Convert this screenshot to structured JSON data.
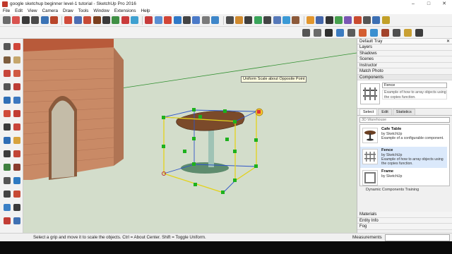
{
  "window": {
    "title": "google sketchup beginner level-1 tutorial - SketchUp Pro 2016",
    "min_glyph": "–",
    "max_glyph": "□",
    "close_glyph": "✕"
  },
  "menu": [
    "File",
    "Edit",
    "View",
    "Camera",
    "Draw",
    "Tools",
    "Window",
    "Extensions",
    "Help"
  ],
  "toolbar": {
    "row1_colors": [
      "#6b6b6b",
      "#d9534f",
      "#3a3a3a",
      "#4a4a4a",
      "#3a73b5",
      "#b8452a",
      "#d04a3a",
      "#4c6db3",
      "#c74a36",
      "#7a3f1e",
      "#3a3a3a",
      "#3f8f44",
      "#c93b3b",
      "#3ea0d0",
      "#c63b3b",
      "#5a8fd3",
      "#d24536",
      "#2f79c8",
      "#444444",
      "#4b7ac8",
      "#7a7a7a",
      "#3e86c9",
      "#4c4c4c",
      "#d08a2e",
      "#3e3e3e",
      "#3aa55a",
      "#444",
      "#5679b9",
      "#3b9ad6",
      "#8d5a3a",
      "#e2962d",
      "#4466aa",
      "#333",
      "#46a04d",
      "#7a56b4",
      "#c94a2f",
      "#555",
      "#3c6fb3",
      "#c2a028"
    ],
    "row2_colors": [
      "#555",
      "#6a6a6a",
      "#2f2f2f",
      "#3c7bc0",
      "#5c5c5c",
      "#d45d30",
      "#3a8fd0",
      "#a2432b",
      "#4f4f4f",
      "#c9a033",
      "#3d3d3d"
    ],
    "left_colors": [
      "#555",
      "#d0463a",
      "#7e5d3e",
      "#c6a76c",
      "#c7453a",
      "#d05a43",
      "#545454",
      "#bd3d36",
      "#2f6fb6",
      "#3c78c0",
      "#d04b3a",
      "#c23c33",
      "#3b3b3b",
      "#c9453b",
      "#2e6db5",
      "#d8a33d",
      "#3c3c3c",
      "#c24536",
      "#3f7f3f",
      "#8a3c2e",
      "#555",
      "#2f7ac2",
      "#444",
      "#c74a35",
      "#3a80c6",
      "#3a3a3a",
      "#c23d35",
      "#4071b3"
    ]
  },
  "tooltip": "Uniform Scale about Opposite Point",
  "tray": {
    "title": "Default Tray",
    "sections_top": [
      "Layers",
      "Shadows",
      "Scenes",
      "Instructor",
      "Match Photo",
      "Components"
    ],
    "component_name": "Fence",
    "component_desc": "Example of how to array objects using the copies function.",
    "tabs": [
      "Select",
      "Edit",
      "Statistics"
    ],
    "search_placeholder": "3D Warehouse",
    "items": [
      {
        "name": "Cafe Table",
        "by": "by SketchUp",
        "desc": "Example of a configurable component."
      },
      {
        "name": "Fence",
        "by": "by SketchUp",
        "desc": "Example of how to array objects using the copies function."
      },
      {
        "name": "Frame",
        "by": "by SketchUp",
        "desc": ""
      }
    ],
    "training_label": "Dynamic Components Training",
    "sections_bottom": [
      "Materials",
      "Entity Info",
      "Fog"
    ]
  },
  "status": {
    "hint": "Select a grip and move it to scale the objects. Ctrl = About Center. Shift = Toggle Uniform.",
    "measurements_label": "Measurements",
    "measurements_value": ""
  }
}
